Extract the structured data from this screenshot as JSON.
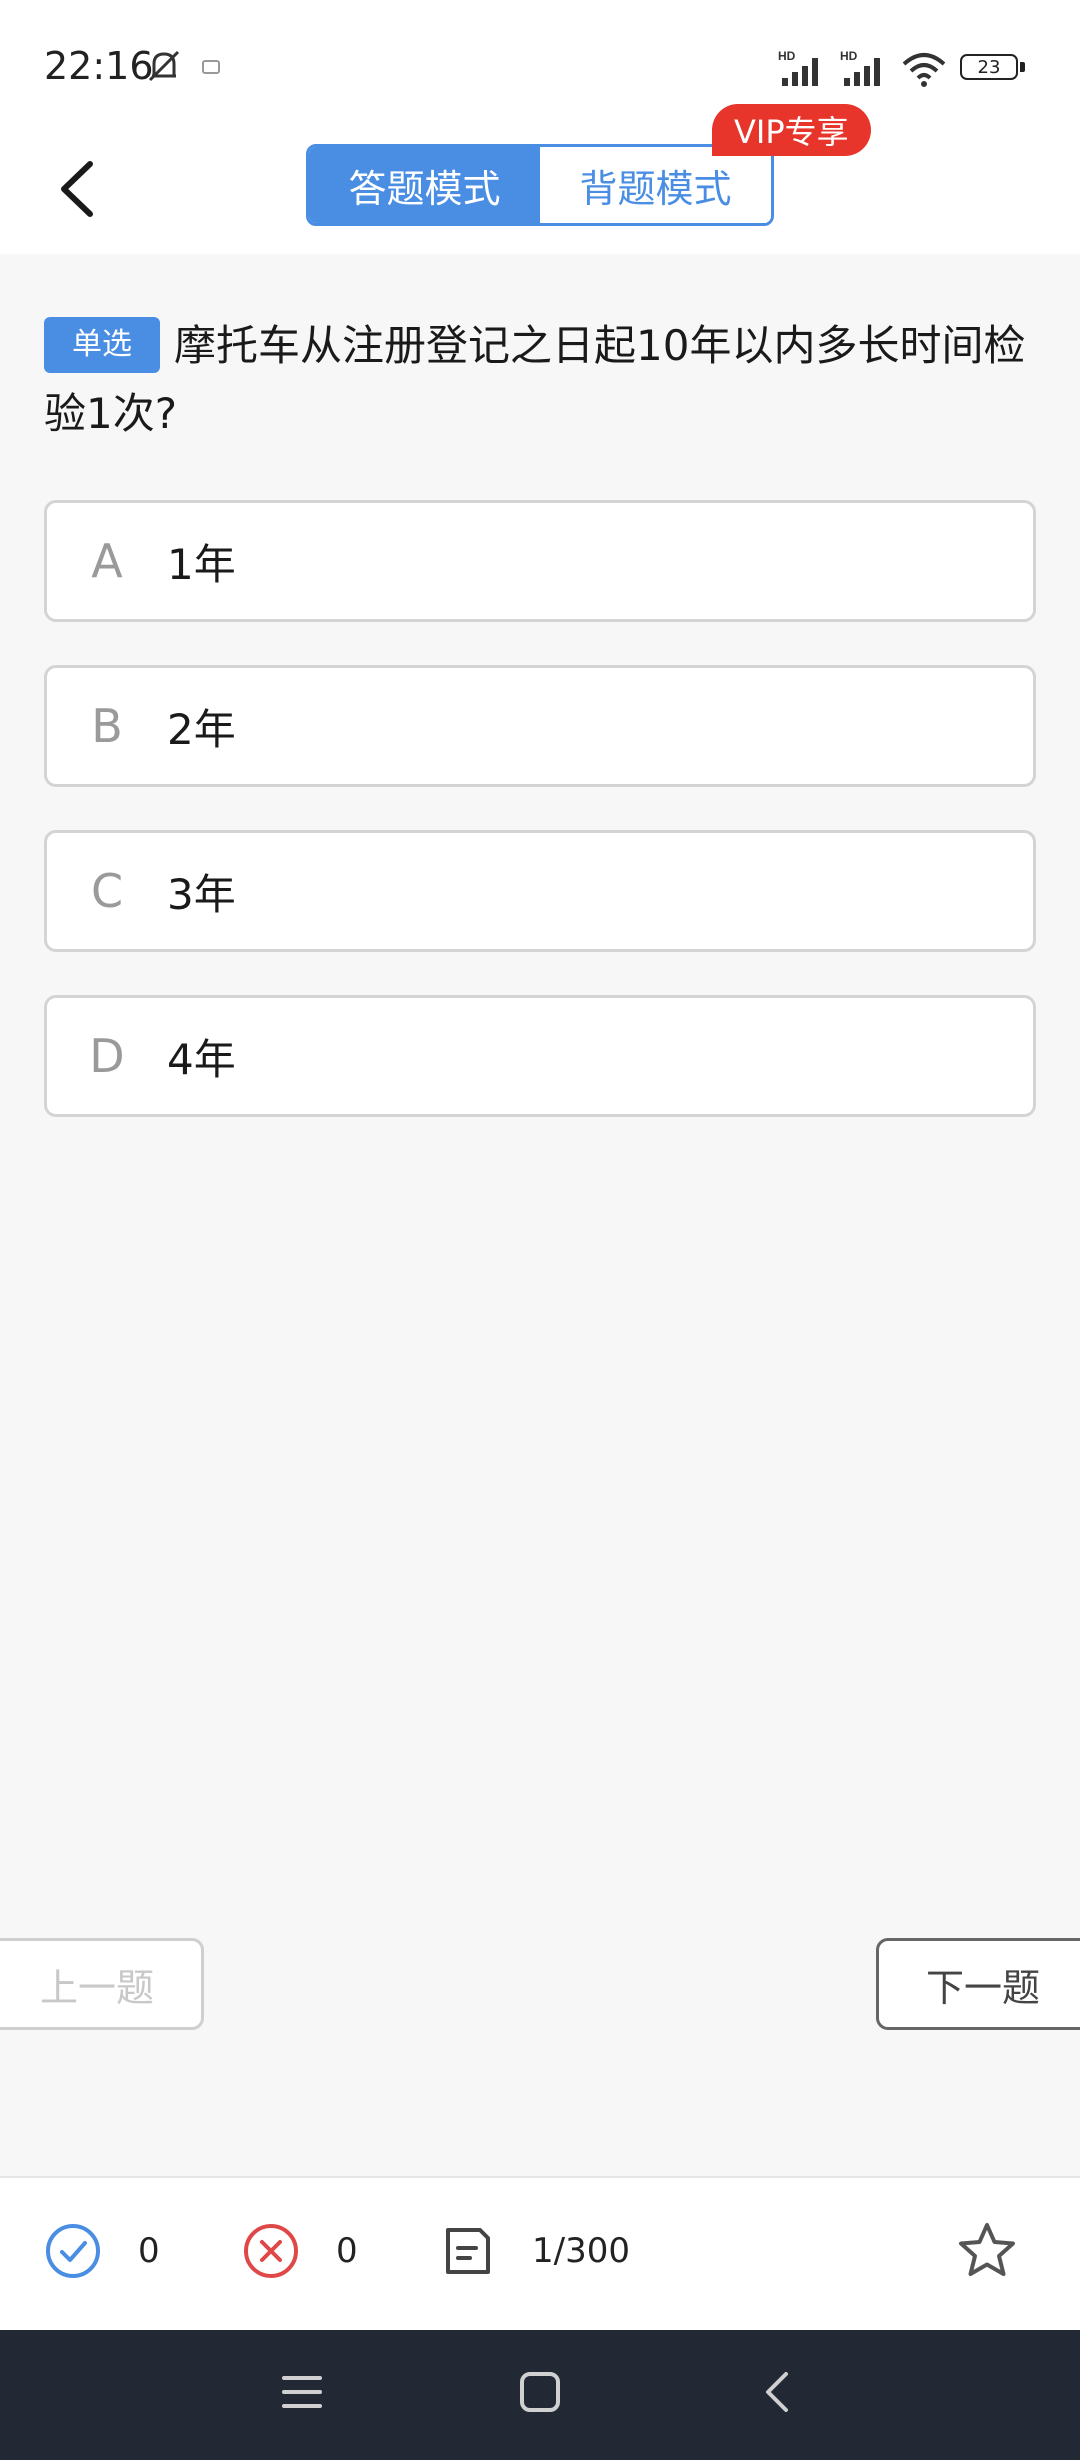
{
  "status_bar": {
    "time": "22:16",
    "battery": "23",
    "network": [
      "HD",
      "HD"
    ]
  },
  "header": {
    "modes": [
      "答题模式",
      "背题模式"
    ],
    "active_mode": "答题模式",
    "vip_badge": "VIP专享"
  },
  "question": {
    "type_tag": "单选",
    "text": "摩托车从注册登记之日起10年以内多长时间检验1次?"
  },
  "options": [
    {
      "letter": "A",
      "text": "1年"
    },
    {
      "letter": "B",
      "text": "2年"
    },
    {
      "letter": "C",
      "text": "3年"
    },
    {
      "letter": "D",
      "text": "4年"
    }
  ],
  "navigation": {
    "prev_label": "上一题",
    "next_label": "下一题"
  },
  "stats": {
    "correct_count": "0",
    "wrong_count": "0",
    "progress": "1/300"
  },
  "colors": {
    "accent": "#4a8ee4",
    "vip": "#e8352b",
    "wrong": "#e04848"
  },
  "icons": [
    "back-icon",
    "correct-icon",
    "wrong-icon",
    "answer-sheet-icon",
    "star-icon",
    "menu-icon",
    "home-icon",
    "nav-back-icon"
  ]
}
